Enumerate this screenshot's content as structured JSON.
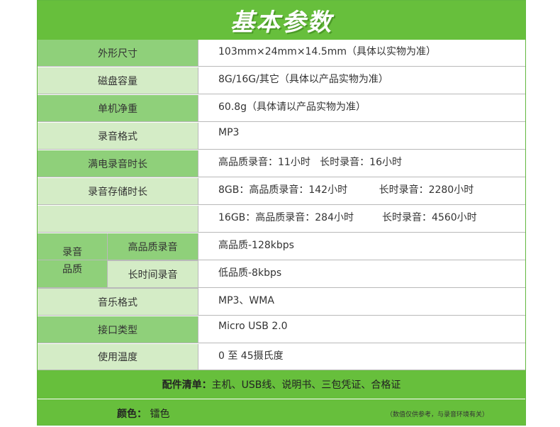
{
  "title": "基本参数",
  "rows": [
    {
      "label": "外形尺寸",
      "value": "103mm×24mm×14.5mm（具体以实物为准）"
    },
    {
      "label": "磁盘容量",
      "value": "8G/16G/其它（具体以产品实物为准）"
    },
    {
      "label": "单机净重",
      "value": "60.8g（具体请以产品实物为准）"
    },
    {
      "label": "录音格式",
      "value": "MP3"
    },
    {
      "label": "满电录音时长",
      "value": "高品质录音：11小时   长时录音：16小时"
    },
    {
      "label": "录音存储时长",
      "value": "8GB：高品质录音：142小时          长时录音：2280小时"
    },
    {
      "label": "",
      "value": "16GB：高品质录音：284小时         长时录音：4560小时"
    },
    {
      "label": "音乐格式",
      "value": "MP3、WMA"
    },
    {
      "label": "接口类型",
      "value": "Micro USB 2.0"
    },
    {
      "label": "使用温度",
      "value": "0 至 45摄氏度"
    }
  ],
  "quality": {
    "group_line1": "录音",
    "group_line2": "品质",
    "high_label": "高品质录音",
    "high_value": "高品质-128kbps",
    "long_label": "长时间录音",
    "long_value": "低品质-8kbps"
  },
  "accessories": {
    "label": "配件清单：",
    "value": "主机、USB线、说明书、三包凭证、合格证"
  },
  "color": {
    "label": "颜色：",
    "value": "镭色"
  },
  "note": "（数值仅供参考，与录音环境有关）",
  "colors": {
    "green": "#67bf3c",
    "label_dark": "#8fd07a",
    "label_light": "#d4ecc6"
  }
}
